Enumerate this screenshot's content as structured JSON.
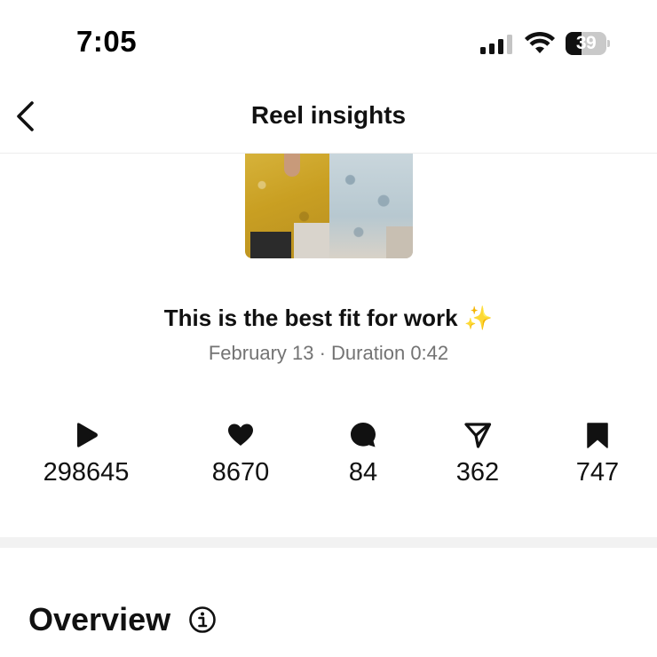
{
  "status_bar": {
    "time": "7:05",
    "battery_level": "39",
    "battery_fraction": 0.39,
    "icons": [
      "signal-icon",
      "wifi-icon",
      "battery-icon"
    ]
  },
  "header": {
    "title": "Reel insights",
    "back_icon": "chevron-left-icon"
  },
  "reel": {
    "caption": "This is the best fit for work",
    "caption_emoji": "✨",
    "date": "February 13",
    "separator": " · ",
    "duration_label": "Duration 0:42"
  },
  "stats": [
    {
      "icon": "play-icon",
      "value": "298645"
    },
    {
      "icon": "heart-icon",
      "value": "8670"
    },
    {
      "icon": "comment-icon",
      "value": "84"
    },
    {
      "icon": "share-icon",
      "value": "362"
    },
    {
      "icon": "bookmark-icon",
      "value": "747"
    }
  ],
  "overview": {
    "title": "Overview",
    "info_icon": "info-icon"
  }
}
